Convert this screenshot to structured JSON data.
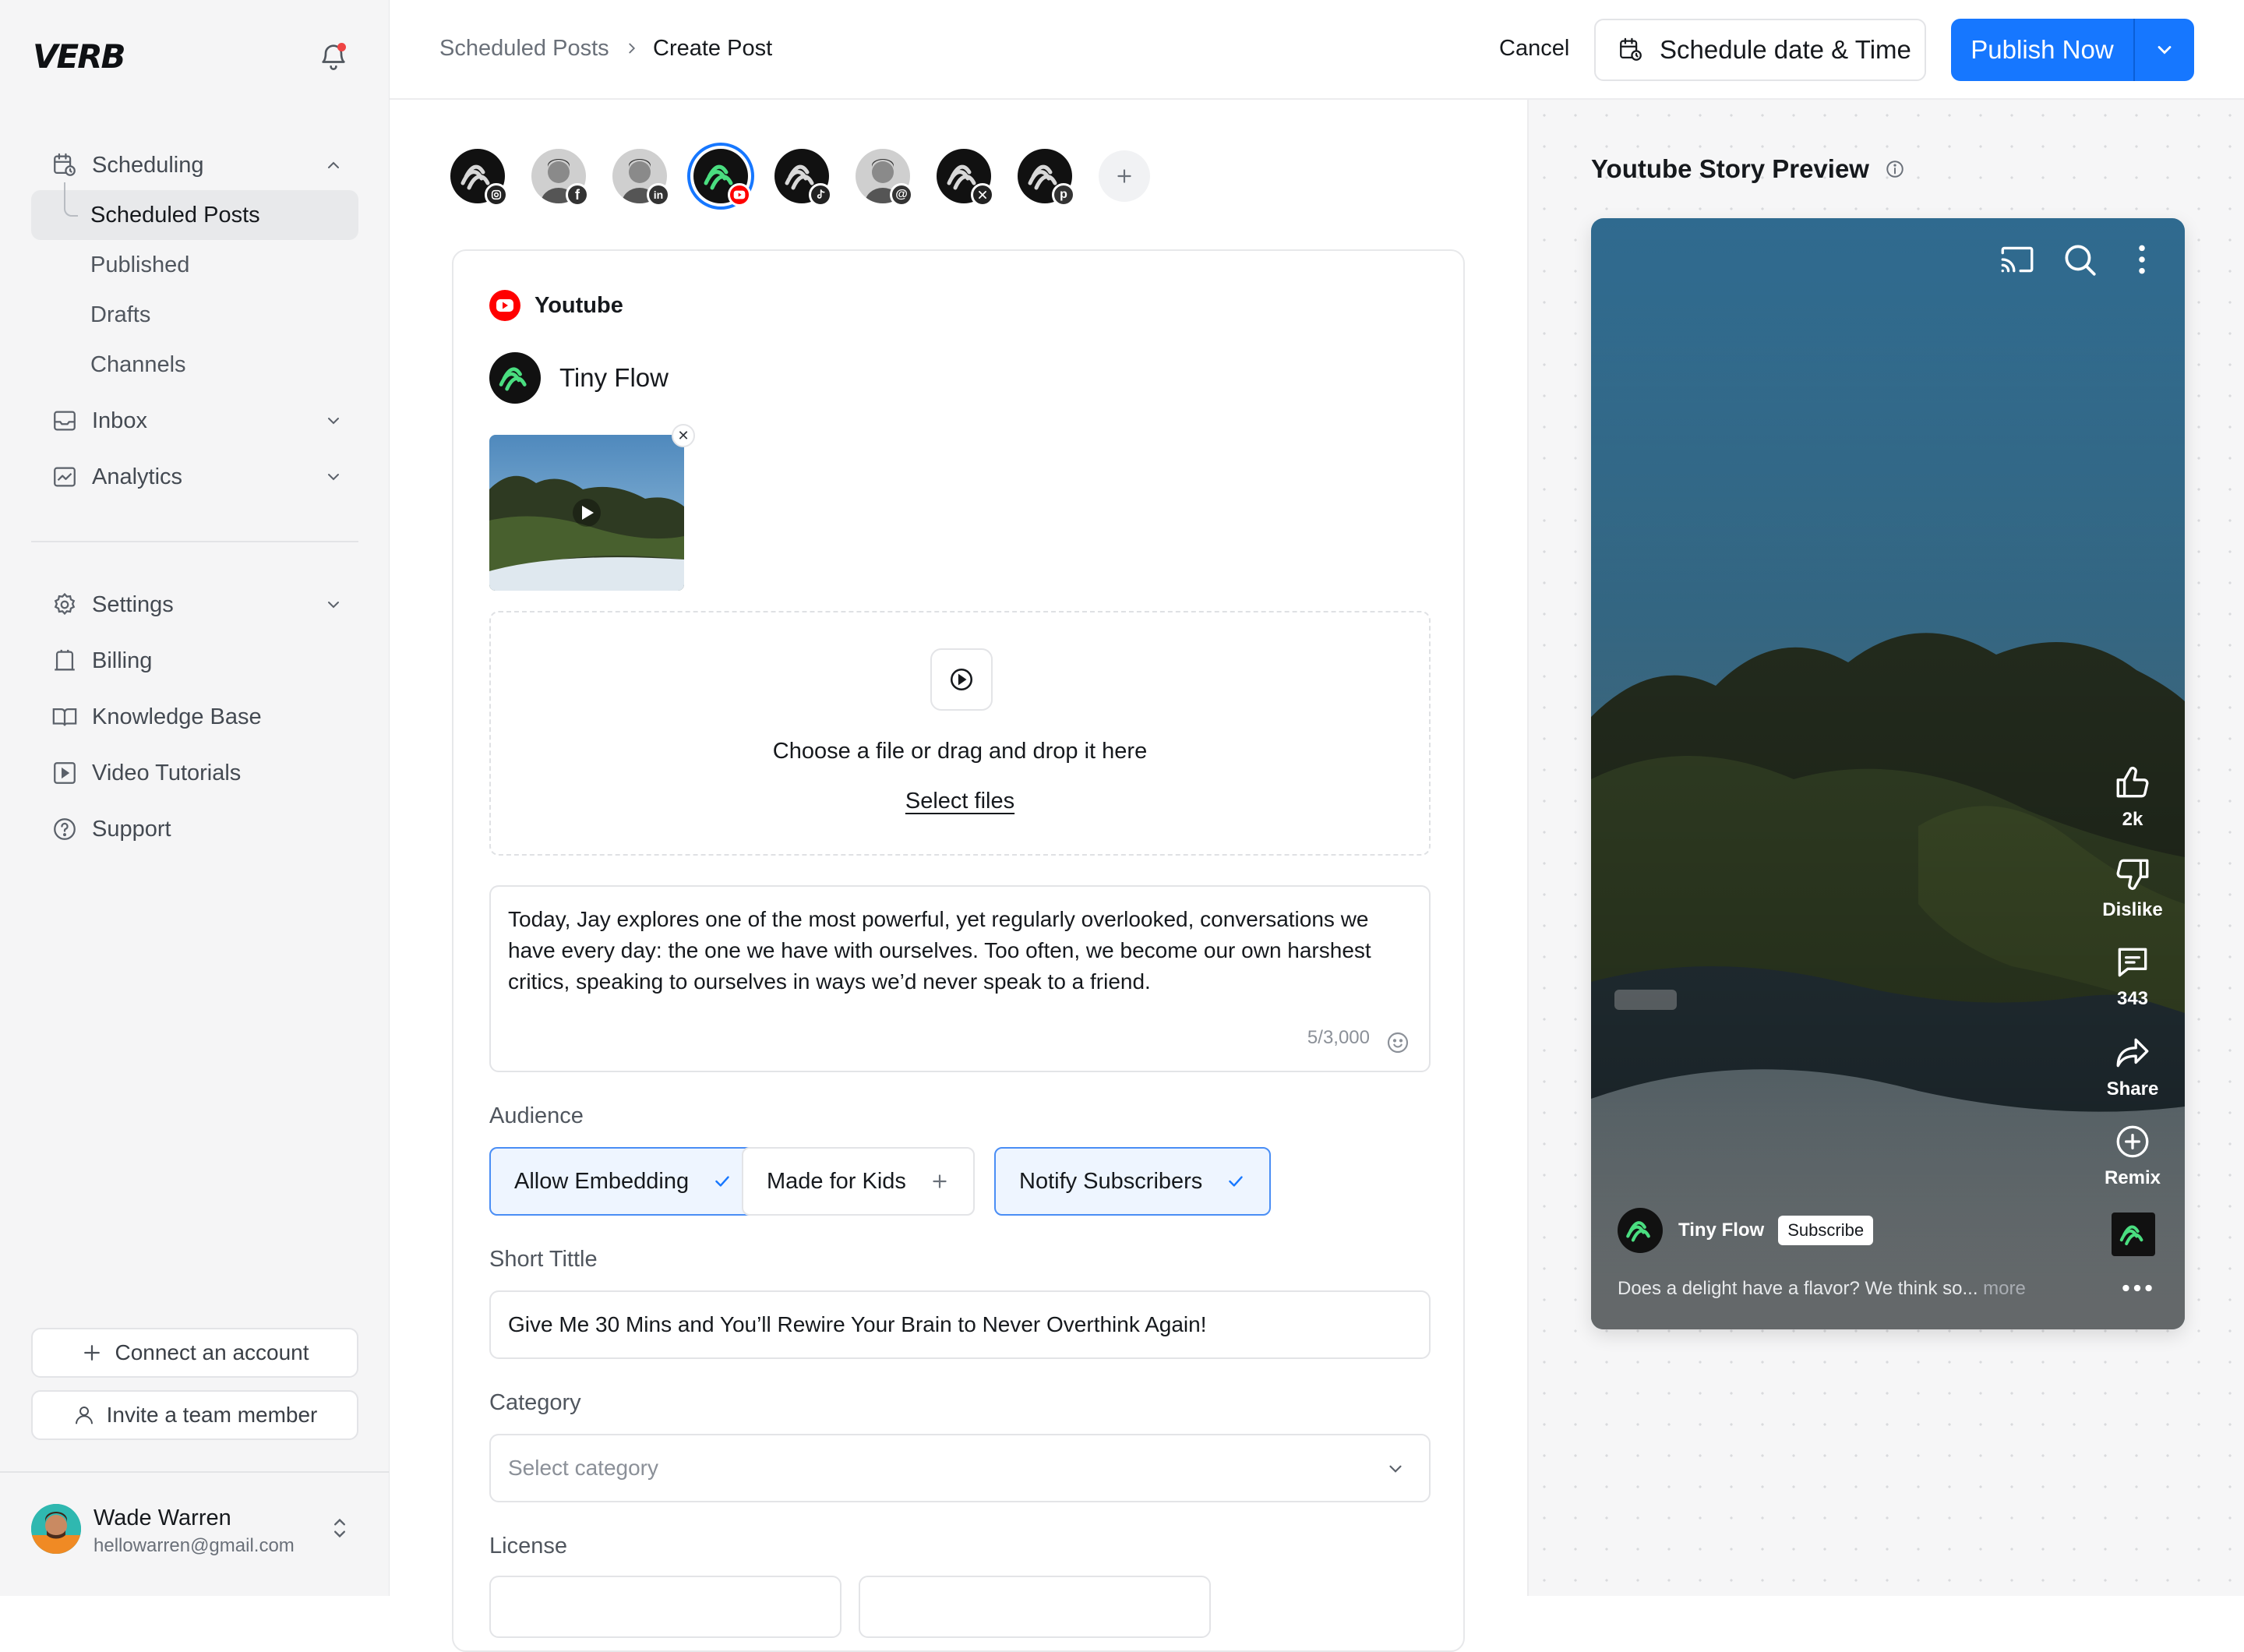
{
  "sidebar": {
    "logo": "VERB",
    "nav": {
      "scheduling": "Scheduling",
      "scheduled_posts": "Scheduled Posts",
      "published": "Published",
      "drafts": "Drafts",
      "channels": "Channels",
      "inbox": "Inbox",
      "analytics": "Analytics"
    },
    "nav2": {
      "settings": "Settings",
      "billing": "Billing",
      "knowledge_base": "Knowledge Base",
      "video_tutorials": "Video Tutorials",
      "support": "Support"
    },
    "connect_account": "Connect an account",
    "invite_member": "Invite a team member",
    "profile": {
      "name": "Wade Warren",
      "email": "hellowarren@gmail.com"
    }
  },
  "header": {
    "crumb_parent": "Scheduled Posts",
    "crumb_current": "Create Post",
    "cancel": "Cancel",
    "schedule": "Schedule date & Time",
    "publish": "Publish Now"
  },
  "channels": [
    {
      "name": "instagram",
      "icon": "instagram-icon"
    },
    {
      "name": "facebook",
      "icon": "facebook-icon"
    },
    {
      "name": "linkedin",
      "icon": "linkedin-icon"
    },
    {
      "name": "youtube",
      "icon": "youtube-icon",
      "selected": true
    },
    {
      "name": "tiktok",
      "icon": "tiktok-icon"
    },
    {
      "name": "threads",
      "icon": "threads-icon"
    },
    {
      "name": "x",
      "icon": "x-icon"
    },
    {
      "name": "pinterest",
      "icon": "pinterest-icon"
    }
  ],
  "post": {
    "platform": "Youtube",
    "account": "Tiny Flow",
    "dropzone_text": "Choose a file or drag and drop it here",
    "select_files": "Select files",
    "caption": "Today, Jay explores one of the most powerful, yet regularly overlooked, conversations we have every day: the one we have with ourselves. Too often, we become our own harshest critics, speaking to ourselves in ways we’d never speak to a friend.",
    "counter": "5/3,000",
    "audience_label": "Audience",
    "audience": {
      "allow_embedding": "Allow Embedding",
      "made_for_kids": "Made for Kids",
      "notify_subscribers": "Notify Subscribers"
    },
    "short_title_label": "Short Tittle",
    "short_title": "Give Me 30 Mins and You’ll Rewire Your Brain to Never Overthink Again!",
    "category_label": "Category",
    "category_placeholder": "Select category",
    "license_label": "License"
  },
  "preview": {
    "title": "Youtube Story Preview",
    "likes": "2k",
    "dislike": "Dislike",
    "comments": "343",
    "share": "Share",
    "remix": "Remix",
    "channel": "Tiny Flow",
    "subscribe": "Subscribe",
    "description": "Does a delight have a flavor? We think so...",
    "more": "more"
  },
  "colors": {
    "accent": "#1677ff",
    "youtube": "#ff0000",
    "brand_green": "#4ade80"
  }
}
